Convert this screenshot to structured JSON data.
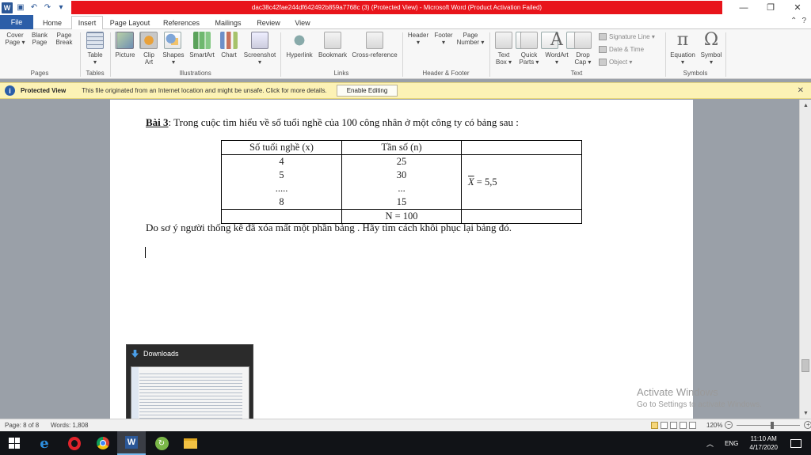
{
  "window": {
    "title": "dac38c42fae244df642492b859a7768c (3) (Protected View) - Microsoft Word (Product Activation Failed)",
    "qat_icons": [
      "word-icon",
      "save-icon",
      "undo-icon",
      "redo-icon"
    ]
  },
  "ribbon": {
    "tabs": [
      "File",
      "Home",
      "Insert",
      "Page Layout",
      "References",
      "Mailings",
      "Review",
      "View"
    ],
    "active_tab": "Insert",
    "groups": {
      "pages": "Pages",
      "tables": "Tables",
      "illustrations": "Illustrations",
      "links": "Links",
      "header_footer": "Header & Footer",
      "text": "Text",
      "symbols": "Symbols"
    },
    "buttons": {
      "cover_page": [
        "Cover",
        "Page ▾"
      ],
      "blank_page": [
        "Blank",
        "Page"
      ],
      "page_break": [
        "Page",
        "Break"
      ],
      "table": [
        "Table",
        "▾"
      ],
      "picture": [
        "Picture",
        ""
      ],
      "clip_art": [
        "Clip",
        "Art"
      ],
      "shapes": [
        "Shapes",
        "▾"
      ],
      "smartart": [
        "SmartArt",
        ""
      ],
      "chart": [
        "Chart",
        ""
      ],
      "screenshot": [
        "Screenshot",
        "▾"
      ],
      "hyperlink": [
        "Hyperlink",
        ""
      ],
      "bookmark": [
        "Bookmark",
        ""
      ],
      "cross_reference": [
        "Cross-reference",
        ""
      ],
      "header": [
        "Header",
        "▾"
      ],
      "footer": [
        "Footer",
        "▾"
      ],
      "page_number": [
        "Page",
        "Number ▾"
      ],
      "text_box": [
        "Text",
        "Box ▾"
      ],
      "quick_parts": [
        "Quick",
        "Parts ▾"
      ],
      "wordart": [
        "WordArt",
        "▾"
      ],
      "drop_cap": [
        "Drop",
        "Cap ▾"
      ],
      "signature_line": "Signature Line ▾",
      "date_time": "Date & Time",
      "object": "Object ▾",
      "equation": [
        "Equation",
        "▾"
      ],
      "symbol": [
        "Symbol",
        "▾"
      ]
    }
  },
  "protected_view": {
    "title": "Protected View",
    "message": "This file originated from an Internet location and might be unsafe. Click for more details.",
    "button": "Enable Editing"
  },
  "document": {
    "heading_label": "Bài 3",
    "heading_text": ": Trong cuộc tìm hiểu về số tuổi nghề của 100 công nhân ở một công ty  có bảng sau :",
    "table": {
      "headers": [
        "Số tuổi nghề (x)",
        "Tần số (n)",
        ""
      ],
      "col_x": [
        "4",
        "5",
        ".....",
        "8"
      ],
      "col_n": [
        "25",
        "30",
        "...",
        "15"
      ],
      "mean_symbol": "X",
      "mean_value": " = 5,5",
      "total": "N = 100"
    },
    "footer_text": "Do sơ ý người thống kê đã xóa mất một phần bảng . Hãy tìm cách khôi phục lại bảng đó."
  },
  "thumbnail": {
    "title": "Downloads"
  },
  "watermark": {
    "line1": "Activate Windows",
    "line2": "Go to Settings to activate Windows."
  },
  "status": {
    "page": "Page: 8 of 8",
    "words": "Words: 1,808",
    "zoom": "120%"
  },
  "taskbar": {
    "apps": [
      "windows-start-icon",
      "edge-icon",
      "opera-icon",
      "chrome-icon",
      "word-icon",
      "green-app-icon",
      "file-explorer-icon"
    ],
    "language": "ENG",
    "time": "11:10 AM",
    "date": "4/17/2020"
  }
}
